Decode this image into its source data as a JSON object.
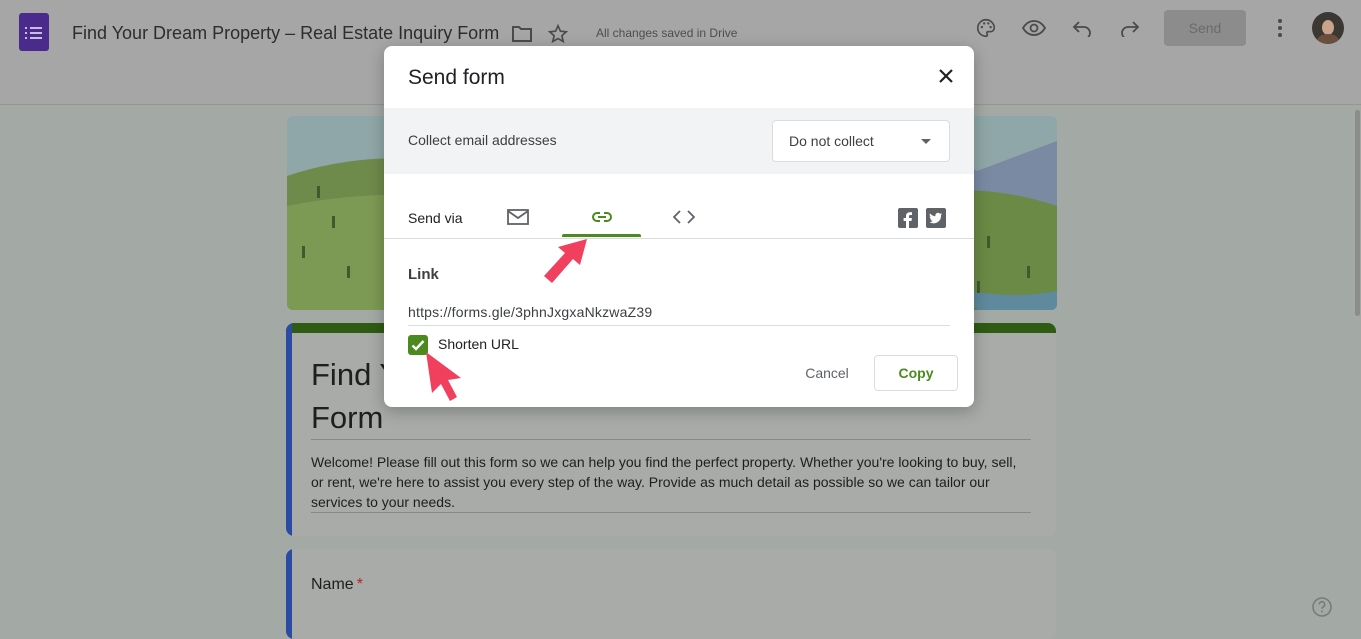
{
  "app": {
    "doc_title": "Find Your Dream Property – Real Estate Inquiry Form",
    "saved_status": "All changes saved in Drive",
    "send_label": "Send",
    "icons": [
      "forms-logo-icon",
      "folder-icon",
      "star-icon",
      "palette-icon",
      "preview-eye-icon",
      "undo-icon",
      "redo-icon",
      "more-vert-icon",
      "avatar",
      "help-icon"
    ]
  },
  "form": {
    "title": "Find Your Dream Property – Real Estate Inquiry\nForm",
    "description": "Welcome! Please fill out this form so we can help you find the perfect property. Whether you're looking to buy, sell, or rent, we're here to assist you every step of the way. Provide as much detail as possible so we can tailor our services to your needs.",
    "questions": [
      {
        "label": "Name",
        "required_mark": "*"
      }
    ]
  },
  "dialog": {
    "title": "Send form",
    "collect_label": "Collect email addresses",
    "collect_value": "Do not collect",
    "send_via_label": "Send via",
    "tabs": [
      {
        "name": "email",
        "icon": "mail-icon",
        "selected": false
      },
      {
        "name": "link",
        "icon": "link-icon",
        "selected": true
      },
      {
        "name": "embed",
        "icon": "code-icon",
        "selected": false
      }
    ],
    "social": [
      "facebook-icon",
      "twitter-icon"
    ],
    "link_heading": "Link",
    "link_url": "https://forms.gle/3phnJxgxaNkzwaZ39",
    "shorten_label": "Shorten URL",
    "shorten_checked": true,
    "cancel_label": "Cancel",
    "copy_label": "Copy"
  },
  "colors": {
    "accent_green": "#4b8a1e",
    "annotation_arrow": "#f0405e",
    "overlay": "#a3a9a5"
  }
}
